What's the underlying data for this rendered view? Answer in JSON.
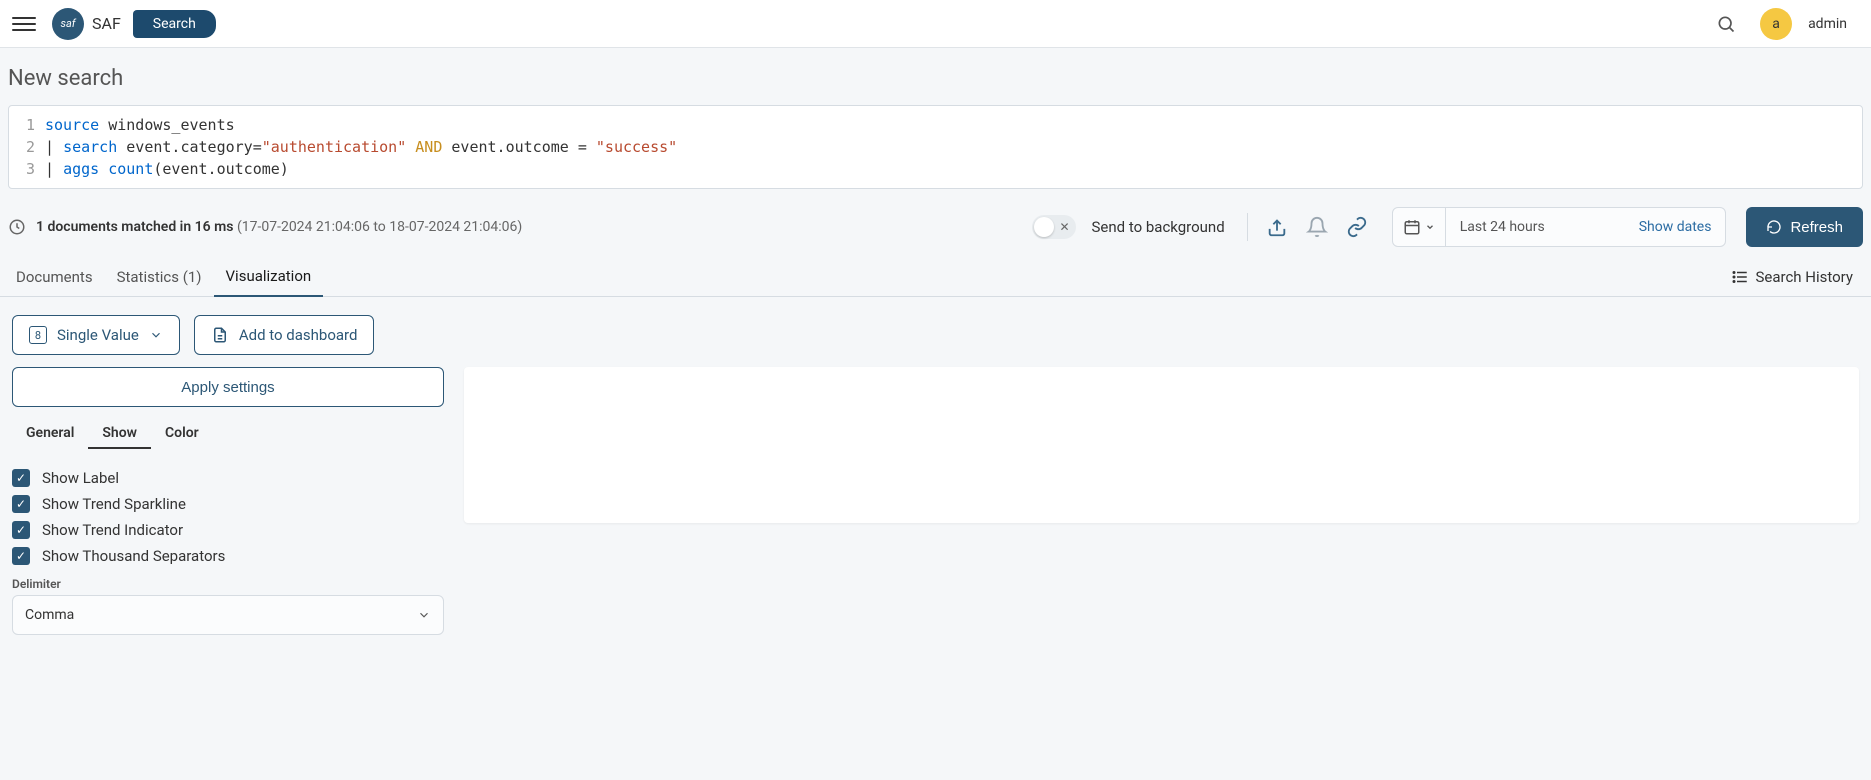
{
  "header": {
    "brand": "SAF",
    "pill": "Search",
    "avatar_letter": "a",
    "username": "admin"
  },
  "page": {
    "title": "New search"
  },
  "query": {
    "lines": [
      {
        "num": "1"
      },
      {
        "num": "2"
      },
      {
        "num": "3"
      }
    ],
    "l1_kw": "source",
    "l1_rest": " windows_events",
    "l2_pipe": "| ",
    "l2_kw": "search",
    "l2_a": " event.category=",
    "l2_str1": "\"authentication\"",
    "l2_sp1": " ",
    "l2_and": "AND",
    "l2_b": " event.outcome = ",
    "l2_str2": "\"success\"",
    "l3_pipe": "| ",
    "l3_kw": "aggs",
    "l3_sp": " ",
    "l3_fn": "count",
    "l3_rest": "(event.outcome)"
  },
  "status": {
    "bold": "1 documents matched in 16 ms",
    "range": " (17-07-2024 21:04:06 to 18-07-2024 21:04:06)",
    "background_label": "Send to background",
    "timerange": "Last 24 hours",
    "show_dates": "Show dates",
    "refresh": "Refresh"
  },
  "tabs": {
    "documents": "Documents",
    "statistics": "Statistics (1)",
    "visualization": "Visualization",
    "history": "Search History"
  },
  "controls": {
    "viz_badge": "8",
    "viz_label": "Single Value",
    "add_dashboard": "Add to dashboard"
  },
  "settings": {
    "apply": "Apply settings",
    "sub_general": "General",
    "sub_show": "Show",
    "sub_color": "Color",
    "show_label": "Show Label",
    "show_sparkline": "Show Trend Sparkline",
    "show_indicator": "Show Trend Indicator",
    "show_thousand": "Show Thousand Separators",
    "delimiter_label": "Delimiter",
    "delimiter_value": "Comma"
  }
}
